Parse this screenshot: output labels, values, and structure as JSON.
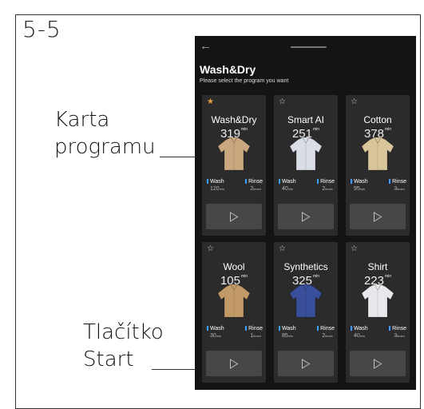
{
  "figure": {
    "label": "5-5"
  },
  "callouts": {
    "program_card": "Karta\nprogramu",
    "start_button": "Tlačítko\nStart"
  },
  "screen": {
    "back_icon": "back-arrow-icon",
    "title": "Wash&Dry",
    "subtitle": "Please select the program you want",
    "wash_label": "Wash",
    "rinse_label": "Rinse",
    "accent_color": "#3aa0ff",
    "favorite_color": "#e9a23b",
    "programs": [
      {
        "name": "Wash&Dry",
        "duration": "319",
        "duration_unit": "min",
        "favorite": true,
        "wash": "120",
        "wash_unit": "min",
        "rinse": "2",
        "rinse_unit": "times",
        "garment_color": "#c9a77f"
      },
      {
        "name": "Smart AI",
        "duration": "251",
        "duration_unit": "min",
        "favorite": false,
        "wash": "40",
        "wash_unit": "min",
        "rinse": "2",
        "rinse_unit": "times",
        "garment_color": "#d9dde6"
      },
      {
        "name": "Cotton",
        "duration": "378",
        "duration_unit": "min",
        "favorite": false,
        "wash": "95",
        "wash_unit": "min",
        "rinse": "3",
        "rinse_unit": "times",
        "garment_color": "#d8c59a"
      },
      {
        "name": "Wool",
        "duration": "105",
        "duration_unit": "min",
        "favorite": false,
        "wash": "30",
        "wash_unit": "min",
        "rinse": "1",
        "rinse_unit": "times",
        "garment_color": "#c29a68"
      },
      {
        "name": "Synthetics",
        "duration": "325",
        "duration_unit": "min",
        "favorite": false,
        "wash": "85",
        "wash_unit": "min",
        "rinse": "2",
        "rinse_unit": "times",
        "garment_color": "#3a4f9c"
      },
      {
        "name": "Shirt",
        "duration": "223",
        "duration_unit": "min",
        "favorite": false,
        "wash": "40",
        "wash_unit": "min",
        "rinse": "3",
        "rinse_unit": "times",
        "garment_color": "#e6e8ec"
      }
    ]
  }
}
